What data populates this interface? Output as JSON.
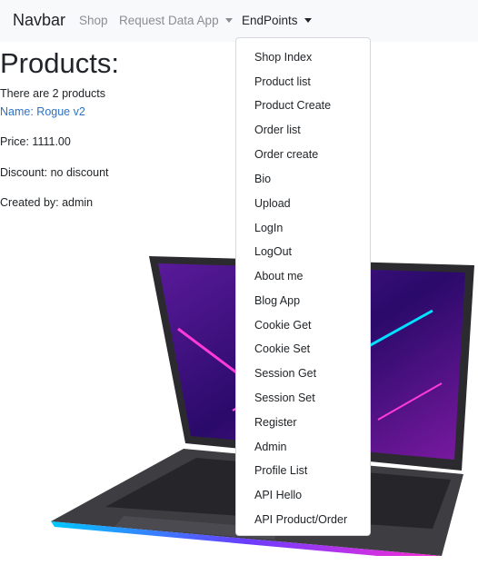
{
  "navbar": {
    "brand": "Navbar",
    "links": [
      {
        "label": "Shop"
      },
      {
        "label": "Request Data App"
      },
      {
        "label": "EndPoints"
      }
    ]
  },
  "page": {
    "title": "Products:",
    "count_text": "There are 2 products",
    "product": {
      "name": "Name: Rogue v2",
      "price": "Price: 1111.00",
      "discount": "Discount: no discount",
      "created_by": "Created by: admin"
    },
    "product_image_icon": "gaming-laptop-image"
  },
  "dropdown": {
    "items": [
      "Shop Index",
      "Product list",
      "Product Create",
      "Order list",
      "Order create",
      "Bio",
      "Upload",
      "LogIn",
      "LogOut",
      "About me",
      "Blog App",
      "Cookie Get",
      "Cookie Set",
      "Session Get",
      "Session Set",
      "Register",
      "Admin",
      "Profile List",
      "API Hello",
      "API Product/Order"
    ]
  },
  "colors": {
    "navbar_bg": "#f8f9fa",
    "link": "#2c73c6",
    "text": "#212529",
    "muted": "#8a8e93"
  }
}
